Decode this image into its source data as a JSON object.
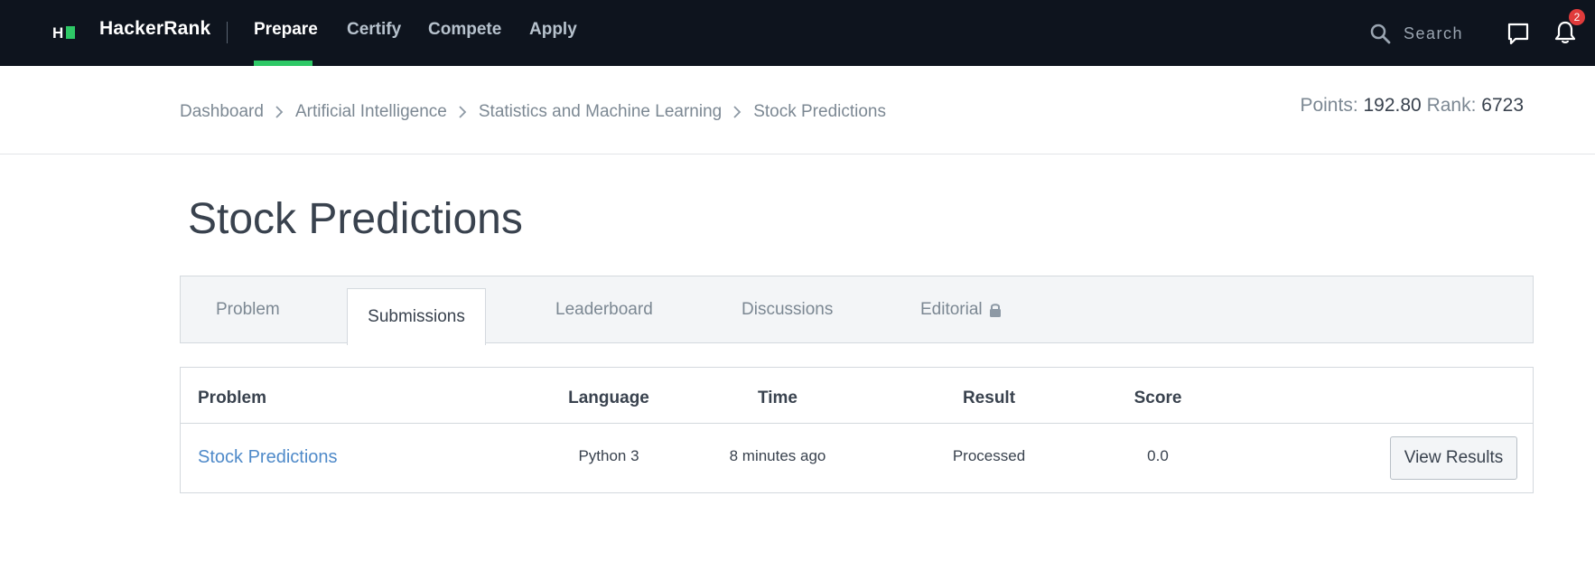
{
  "header": {
    "brand": "HackerRank",
    "logo_letter": "H",
    "nav": [
      {
        "label": "Prepare",
        "active": true
      },
      {
        "label": "Certify",
        "active": false
      },
      {
        "label": "Compete",
        "active": false
      },
      {
        "label": "Apply",
        "active": false
      }
    ],
    "search": {
      "placeholder": "Search"
    },
    "notifications_count": "2",
    "accent_color": "#2ec866",
    "bg_color": "#0e141e"
  },
  "breadcrumb": [
    "Dashboard",
    "Artificial Intelligence",
    "Statistics and Machine Learning",
    "Stock Predictions"
  ],
  "stats": {
    "points_label": "Points:",
    "points_value": "192.80",
    "rank_label": "Rank:",
    "rank_value": "6723"
  },
  "page": {
    "title": "Stock Predictions"
  },
  "tabs": [
    {
      "label": "Problem",
      "active": false
    },
    {
      "label": "Submissions",
      "active": true
    },
    {
      "label": "Leaderboard",
      "active": false
    },
    {
      "label": "Discussions",
      "active": false
    },
    {
      "label": "Editorial",
      "active": false,
      "icon": "lock-icon"
    }
  ],
  "table": {
    "columns": [
      "Problem",
      "Language",
      "Time",
      "Result",
      "Score"
    ],
    "rows": [
      {
        "problem": "Stock Predictions",
        "language": "Python 3",
        "time": "8 minutes ago",
        "result": "Processed",
        "score": "0.0",
        "action": "View Results"
      }
    ]
  }
}
